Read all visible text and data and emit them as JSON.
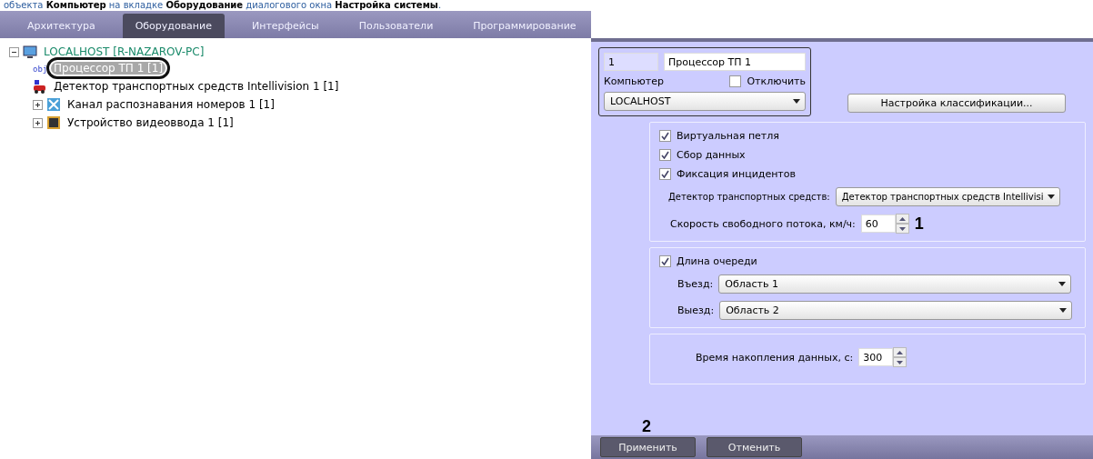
{
  "doc_line": "объекта **Компьютер** на вкладке **Оборудование** диалогового окна **Настройка системы**.",
  "tabs": [
    {
      "label": "Архитектура",
      "selected": false
    },
    {
      "label": "Оборудование",
      "selected": true
    },
    {
      "label": "Интерфейсы",
      "selected": false
    },
    {
      "label": "Пользователи",
      "selected": false
    },
    {
      "label": "Программирование",
      "selected": false
    }
  ],
  "tree": [
    {
      "label": "LOCALHOST [R-NAZAROV-PC]",
      "kind": "computer",
      "expanded": true,
      "selected": false,
      "children": [
        {
          "label": "Процессор ТП 1 [1]",
          "kind": "obj",
          "selected": true,
          "circled": true
        },
        {
          "label": "Детектор транспортных средств Intellivision 1 [1]",
          "kind": "detector",
          "selected": false
        },
        {
          "label": "Канал распознавания номеров 1 [1]",
          "kind": "channel",
          "expanded": false,
          "selected": false
        },
        {
          "label": "Устройство видеоввода 1 [1]",
          "kind": "chip",
          "expanded": false,
          "selected": false
        }
      ]
    }
  ],
  "object": {
    "id": "1",
    "name": "Процессор ТП 1",
    "computer_label": "Компьютер",
    "disable": {
      "label": "Отключить",
      "checked": false
    },
    "computer": "LOCALHOST"
  },
  "classify_button": "Настройка классификации...",
  "group1": {
    "checks": [
      {
        "label": "Виртуальная петля",
        "checked": true
      },
      {
        "label": "Сбор данных",
        "checked": true
      },
      {
        "label": "Фиксация инцидентов",
        "checked": true
      }
    ],
    "detector_label": "Детектор транспортных средств:",
    "detector": "Детектор транспортных средств Intellivisi",
    "speed_label": "Скорость свободного потока, км/ч:",
    "speed": "60",
    "marker": "1"
  },
  "group2": {
    "check": {
      "label": "Длина очереди",
      "checked": true
    },
    "entry_label": "Въезд:",
    "entry": "Область 1",
    "exit_label": "Выезд:",
    "exit": "Область 2"
  },
  "group3": {
    "label": "Время накопления данных, с:",
    "value": "300"
  },
  "marker2": "2",
  "buttons": [
    "Применить",
    "Отменить"
  ]
}
